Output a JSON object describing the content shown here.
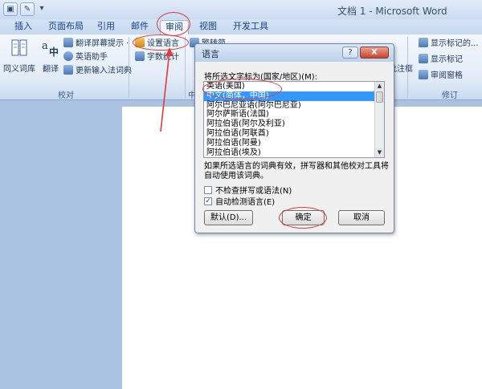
{
  "window": {
    "title": "文档 1 - Microsoft Word"
  },
  "qat": {
    "save_glyph": "▣",
    "edit_glyph": "✎",
    "more_glyph": "▾"
  },
  "tabs": [
    "插入",
    "页面布局",
    "引用",
    "邮件",
    "审阅",
    "视图",
    "开发工具"
  ],
  "ribbon": {
    "proofing_group_label": "校对",
    "chinese_group_label": "中",
    "tracking_group_label": "修订",
    "thesaurus_label": "同义词库",
    "translate_label": "翻译",
    "screen_tip_label": "翻译屏幕提示 ·",
    "english_assistant_label": "英语助手",
    "update_ime_label": "更新输入法词典",
    "set_language_label": "设置语言",
    "word_count_label": "字数统计",
    "simp_trad_label": "繁转简",
    "show_markup_label": "显示标记的...",
    "show_markup2_label": "显示标记",
    "reviewing_pane_label": "审阅窗格",
    "balloons_label": "批注框"
  },
  "dialog": {
    "title": "语言",
    "help": "?",
    "close": "X",
    "prompt": "将所选文字标为(国家/地区)(M):",
    "languages": [
      "英语(美国)",
      "中文(简体，中国)",
      "阿尔巴尼亚语(阿尔巴尼亚)",
      "阿尔萨斯语(法国)",
      "阿拉伯语(阿尔及利亚)",
      "阿拉伯语(阿联酋)",
      "阿拉伯语(阿曼)",
      "阿拉伯语(埃及)"
    ],
    "selected_index": 1,
    "note": "如果所选语言的词典有效，拼写器和其他校对工具将自动使用该词典。",
    "no_check_label": "不检查拼写或语法(N)",
    "no_check_checked": false,
    "auto_detect_label": "自动检测语言(E)",
    "auto_detect_checked": true,
    "default_button": "默认(D)...",
    "ok_button": "确定",
    "cancel_button": "取消"
  },
  "colors": {
    "annotation": "#e23a3a",
    "selection": "#3399ff"
  }
}
